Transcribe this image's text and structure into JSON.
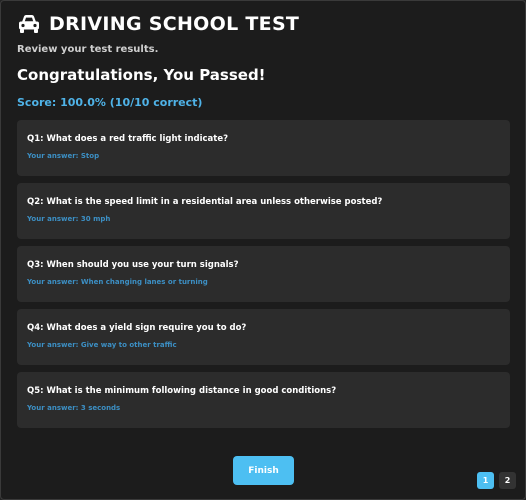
{
  "header": {
    "title": "DRIVING SCHOOL TEST",
    "icon": "car-icon",
    "subtitle": "Review your test results."
  },
  "result": {
    "heading": "Congratulations, You Passed!",
    "score": "Score: 100.0% (10/10 correct)"
  },
  "questions": [
    {
      "question": "Q1: What does a red traffic light indicate?",
      "answer": "Your answer: Stop"
    },
    {
      "question": "Q2: What is the speed limit in a residential area unless otherwise posted?",
      "answer": "Your answer: 30 mph"
    },
    {
      "question": "Q3: When should you use your turn signals?",
      "answer": "Your answer: When changing lanes or turning"
    },
    {
      "question": "Q4: What does a yield sign require you to do?",
      "answer": "Your answer: Give way to other traffic"
    },
    {
      "question": "Q5: What is the minimum following distance in good conditions?",
      "answer": "Your answer: 3 seconds"
    }
  ],
  "actions": {
    "finish_label": "Finish"
  },
  "pagination": {
    "pages": [
      "1",
      "2"
    ],
    "current": "1"
  },
  "colors": {
    "accent": "#4dbff2",
    "answer": "#3c8fc4",
    "card": "#2c2c2c",
    "background": "#1c1c1c"
  }
}
